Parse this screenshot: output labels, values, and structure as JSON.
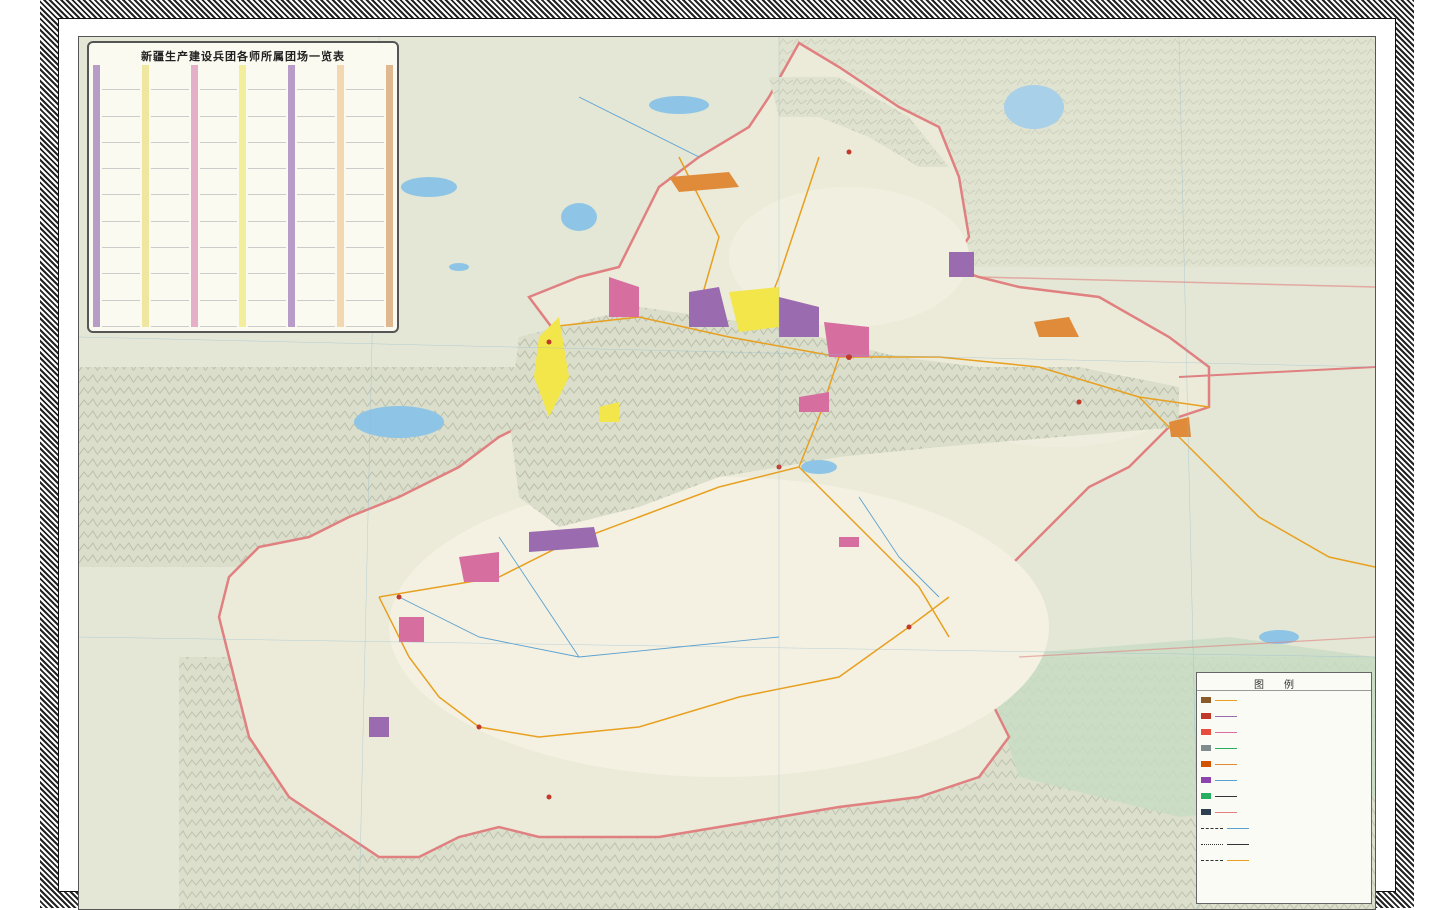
{
  "map": {
    "table_title": "新疆生产建设兵团各师所属团场一览表",
    "legend_title": "图例",
    "legend_items": [
      {
        "label": "",
        "color": "#8a5a2b"
      },
      {
        "label": "",
        "color": "#c0392b"
      },
      {
        "label": "",
        "color": "#e74c3c"
      },
      {
        "label": "",
        "color": "#7f8c8d"
      },
      {
        "label": "",
        "color": "#d35400"
      },
      {
        "label": "",
        "color": "#8e44ad"
      },
      {
        "label": "",
        "color": "#27ae60"
      },
      {
        "label": "",
        "color": "#2c3e50"
      }
    ],
    "colors": {
      "terrain": "#e6e9d8",
      "desert": "#f3efdd",
      "mountain": "#c9cfbf",
      "water": "#8ec5e6",
      "border": "#e08080",
      "road": "#e8a020",
      "corps_purple": "#9b6bb0",
      "corps_pink": "#d66fa0",
      "corps_yellow": "#f2e64a",
      "corps_orange": "#e08b3a"
    }
  }
}
